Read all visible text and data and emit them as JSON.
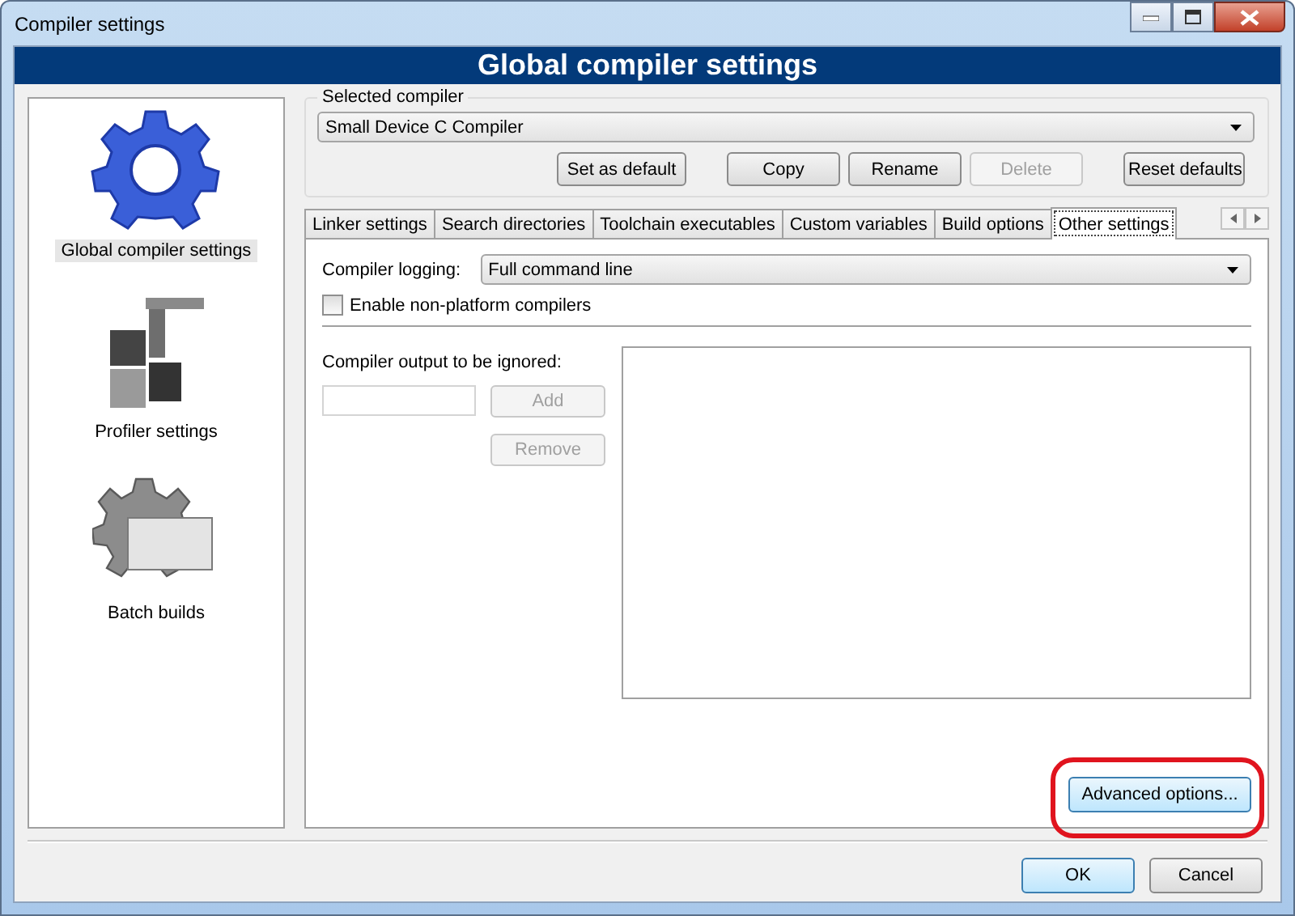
{
  "window": {
    "title": "Compiler settings"
  },
  "banner": "Global compiler settings",
  "sidebar": {
    "items": [
      {
        "label": "Global compiler settings",
        "kind": "gear",
        "selected": true
      },
      {
        "label": "Profiler settings",
        "kind": "profiler",
        "selected": false
      },
      {
        "label": "Batch builds",
        "kind": "batch",
        "selected": false
      }
    ]
  },
  "compiler_group": {
    "label": "Selected compiler",
    "select": {
      "value": "Small Device C Compiler"
    },
    "buttons": [
      {
        "label": "Set as default",
        "disabled": false
      },
      {
        "label": "Copy",
        "disabled": false
      },
      {
        "label": "Rename",
        "disabled": false
      },
      {
        "label": "Delete",
        "disabled": true
      },
      {
        "label": "Reset defaults",
        "disabled": false
      }
    ]
  },
  "tabs": [
    {
      "label": "Linker settings",
      "selected": false
    },
    {
      "label": "Search directories",
      "selected": false
    },
    {
      "label": "Toolchain executables",
      "selected": false
    },
    {
      "label": "Custom variables",
      "selected": false
    },
    {
      "label": "Build options",
      "selected": false
    },
    {
      "label": "Other settings",
      "selected": true
    }
  ],
  "other_settings": {
    "logging": {
      "label": "Compiler logging:",
      "value": "Full command line"
    },
    "non_platform": {
      "label": "Enable non-platform compilers",
      "checked": false
    },
    "ignored": {
      "label": "Compiler output to be ignored:",
      "buttons": [
        {
          "label": "Add",
          "disabled": true
        },
        {
          "label": "Remove",
          "disabled": true
        }
      ]
    },
    "advanced_button": "Advanced options..."
  },
  "footer_buttons": [
    {
      "label": "OK",
      "default": true
    },
    {
      "label": "Cancel",
      "default": false
    }
  ]
}
